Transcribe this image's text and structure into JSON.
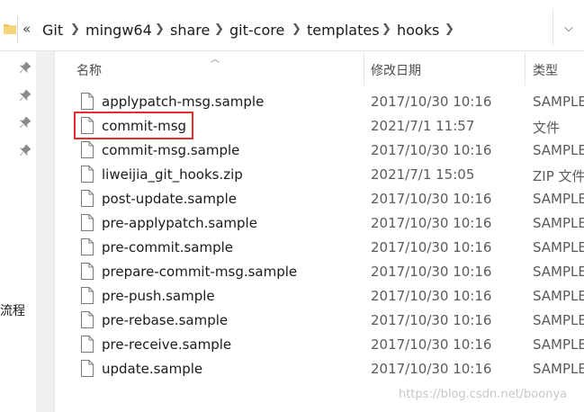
{
  "address_bar": {
    "overflow": "«",
    "crumbs": [
      "Git",
      "mingw64",
      "share",
      "git-core",
      "templates",
      "hooks"
    ],
    "chevron": "❯",
    "dropdown": "⌵"
  },
  "nav": {
    "text": "流程",
    "pin_icons": [
      "pin-icon",
      "pin-icon",
      "pin-icon",
      "pin-icon"
    ]
  },
  "columns": {
    "name": "名称",
    "date": "修改日期",
    "type": "类型"
  },
  "files": [
    {
      "name": "applypatch-msg.sample",
      "date": "2017/10/30 10:16",
      "type": "SAMPLE"
    },
    {
      "name": "commit-msg",
      "date": "2021/7/1 11:57",
      "type": "文件"
    },
    {
      "name": "commit-msg.sample",
      "date": "2017/10/30 10:16",
      "type": "SAMPLE"
    },
    {
      "name": "liweijia_git_hooks.zip",
      "date": "2021/7/1 15:05",
      "type": "ZIP 文件"
    },
    {
      "name": "post-update.sample",
      "date": "2017/10/30 10:16",
      "type": "SAMPLE"
    },
    {
      "name": "pre-applypatch.sample",
      "date": "2017/10/30 10:16",
      "type": "SAMPLE"
    },
    {
      "name": "pre-commit.sample",
      "date": "2017/10/30 10:16",
      "type": "SAMPLE"
    },
    {
      "name": "prepare-commit-msg.sample",
      "date": "2017/10/30 10:16",
      "type": "SAMPLE"
    },
    {
      "name": "pre-push.sample",
      "date": "2017/10/30 10:16",
      "type": "SAMPLE"
    },
    {
      "name": "pre-rebase.sample",
      "date": "2017/10/30 10:16",
      "type": "SAMPLE"
    },
    {
      "name": "pre-receive.sample",
      "date": "2017/10/30 10:16",
      "type": "SAMPLE"
    },
    {
      "name": "update.sample",
      "date": "2017/10/30 10:16",
      "type": "SAMPLE"
    }
  ],
  "watermark": "https://blog.csdn.net/boonya",
  "colors": {
    "highlight": "#e8302a",
    "folder": "#f2c65a"
  }
}
